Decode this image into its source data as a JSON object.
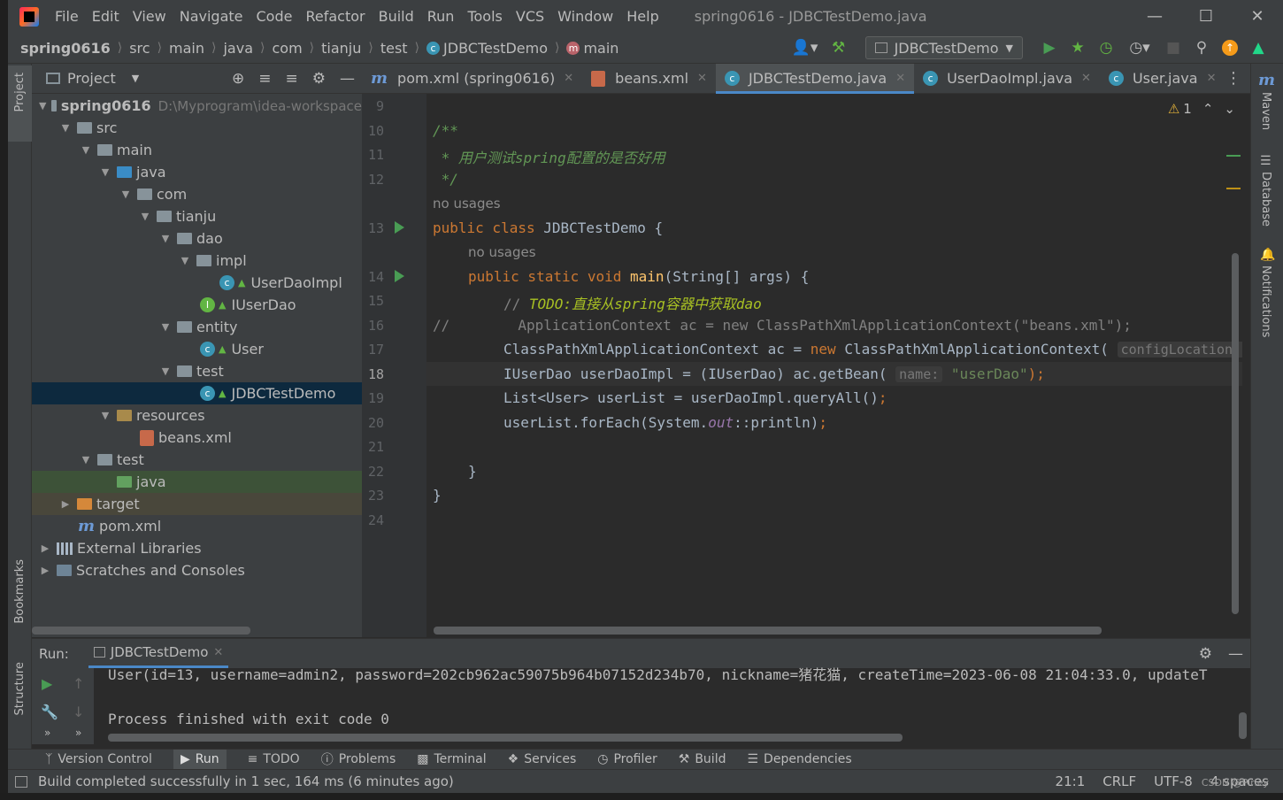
{
  "menu": {
    "items": [
      "File",
      "Edit",
      "View",
      "Navigate",
      "Code",
      "Refactor",
      "Build",
      "Run",
      "Tools",
      "VCS",
      "Window",
      "Help"
    ],
    "window_title": "spring0616 - JDBCTestDemo.java"
  },
  "navbar": {
    "crumbs": [
      "spring0616",
      "src",
      "main",
      "java",
      "com",
      "tianju",
      "test",
      "JDBCTestDemo",
      "main"
    ],
    "run_config": "JDBCTestDemo"
  },
  "project": {
    "title": "Project",
    "root_name": "spring0616",
    "root_path": "D:\\Myprogram\\idea-workspace",
    "nodes": [
      "src",
      "main",
      "java",
      "com",
      "tianju",
      "dao",
      "impl",
      "UserDaoImpl",
      "IUserDao",
      "entity",
      "User",
      "test",
      "JDBCTestDemo",
      "resources",
      "beans.xml",
      "test",
      "java",
      "target",
      "pom.xml",
      "External Libraries",
      "Scratches and Consoles"
    ]
  },
  "tabs": [
    "pom.xml (spring0616)",
    "beans.xml",
    "JDBCTestDemo.java",
    "UserDaoImpl.java",
    "User.java"
  ],
  "editor": {
    "warning_count": "1",
    "line_numbers": [
      "9",
      "10",
      "11",
      "12",
      "13",
      "14",
      "15",
      "16",
      "17",
      "18",
      "19",
      "20",
      "21",
      "22",
      "23",
      "24"
    ],
    "no_usages": "no usages",
    "code": {
      "l10": "/**",
      "l11": " * 用户测试spring配置的是否好用",
      "l12": " */",
      "l13a": "public class ",
      "l13b": "JDBCTestDemo {",
      "l14a": "public static void ",
      "l14b": "main",
      "l14c": "(String[] args) {",
      "l15a": "// ",
      "l15b": "TODO:直接从spring容器中获取dao",
      "l16a": "//",
      "l16b": "        ApplicationContext ac = new ClassPathXmlApplicationContext(\"beans.xml\");",
      "l17a": "ClassPathXmlApplicationContext ac = ",
      "l17b": "new ",
      "l17c": "ClassPathXmlApplicationContext(",
      "l17hint": "configLocation:",
      "l18a": "IUserDao userDaoImpl = (IUserDao) ac.getBean(",
      "l18hint": "name:",
      "l18str": "\"userDao\"",
      "l18end": ");",
      "l19a": "List<User> userList = userDaoImpl.queryAll()",
      "l19b": ";",
      "l20a": "userList.forEach(System.",
      "l20b": "out",
      "l20c": "::println)",
      "l20d": ";",
      "l22": "}",
      "l23": "}"
    }
  },
  "run": {
    "label": "Run:",
    "tab": "JDBCTestDemo",
    "output_line1": "User(id=13, username=admin2, password=202cb962ac59075b964b07152d234b70, nickname=猪花猫, createTime=2023-06-08 21:04:33.0, updateT",
    "output_line2": "Process finished with exit code 0"
  },
  "tool_tabs": [
    "Version Control",
    "Run",
    "TODO",
    "Problems",
    "Terminal",
    "Services",
    "Profiler",
    "Build",
    "Dependencies"
  ],
  "right_tools": [
    "Maven",
    "Database",
    "Notifications"
  ],
  "left_tools": [
    "Project",
    "Bookmarks",
    "Structure"
  ],
  "status": {
    "message": "Build completed successfully in 1 sec, 164 ms (6 minutes ago)",
    "position": "21:1",
    "line_sep": "CRLF",
    "encoding": "UTF-8",
    "indent": "4 spaces",
    "watermark": "CSDN @Pirley"
  }
}
